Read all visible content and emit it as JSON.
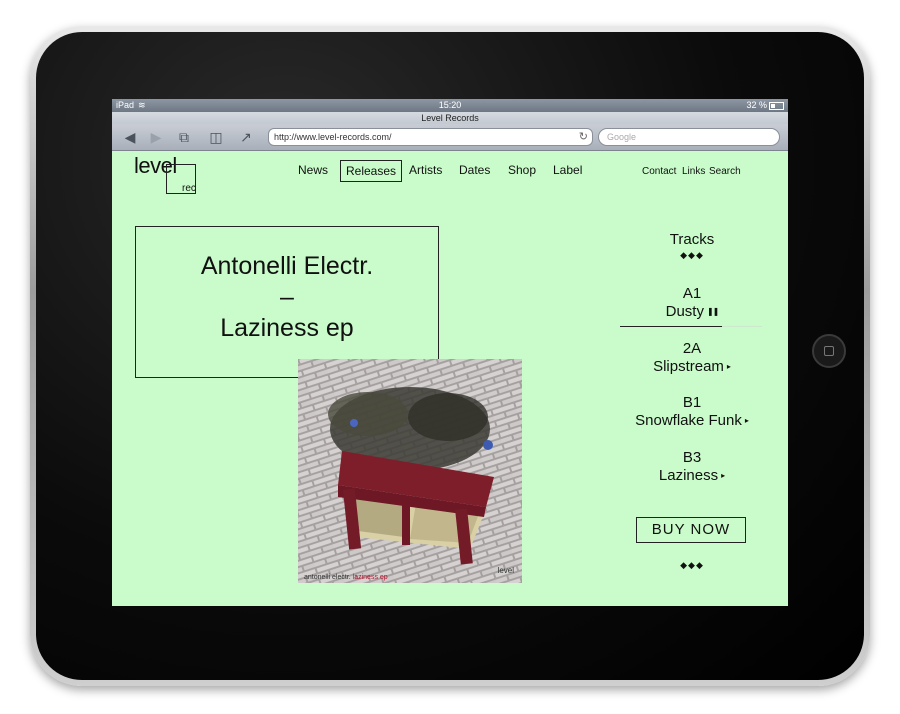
{
  "statusbar": {
    "carrier": "iPad",
    "time": "15:20",
    "battery": "32 %"
  },
  "browser": {
    "title": "Level Records",
    "url": "http://www.level-records.com/",
    "search_placeholder": "Google",
    "icons": [
      "back-arrow-icon",
      "forward-arrow-icon",
      "tabs-icon",
      "bookmarks-icon",
      "share-icon",
      "reload-icon"
    ]
  },
  "site": {
    "logo": {
      "main": "level",
      "sub": "rec"
    },
    "nav": [
      "News",
      "Releases",
      "Artists",
      "Dates",
      "Shop",
      "Label"
    ],
    "active_nav": "Releases",
    "utility_nav": [
      "Contact",
      "Links",
      "Search"
    ],
    "release": {
      "artist": "Antonelli Electr.",
      "dash": "–",
      "title": "Laziness ep"
    },
    "cover": {
      "caption_artist": "antonelli electr.",
      "caption_title": "laziness ep",
      "logo": "level"
    },
    "tracks": {
      "heading": "Tracks",
      "diamonds": "◆◆◆",
      "items": [
        {
          "side": "A1",
          "name": "Dusty",
          "state": "playing",
          "progress": 0.72
        },
        {
          "side": "2A",
          "name": "Slipstream",
          "state": "paused"
        },
        {
          "side": "B1",
          "name": "Snowflake Funk",
          "state": "paused"
        },
        {
          "side": "B3",
          "name": "Laziness",
          "state": "paused"
        }
      ]
    },
    "buy_label": "BUY NOW"
  },
  "colors": {
    "page_background": "#c9fcca",
    "text": "#111111",
    "cover_accent": "#b01830"
  }
}
